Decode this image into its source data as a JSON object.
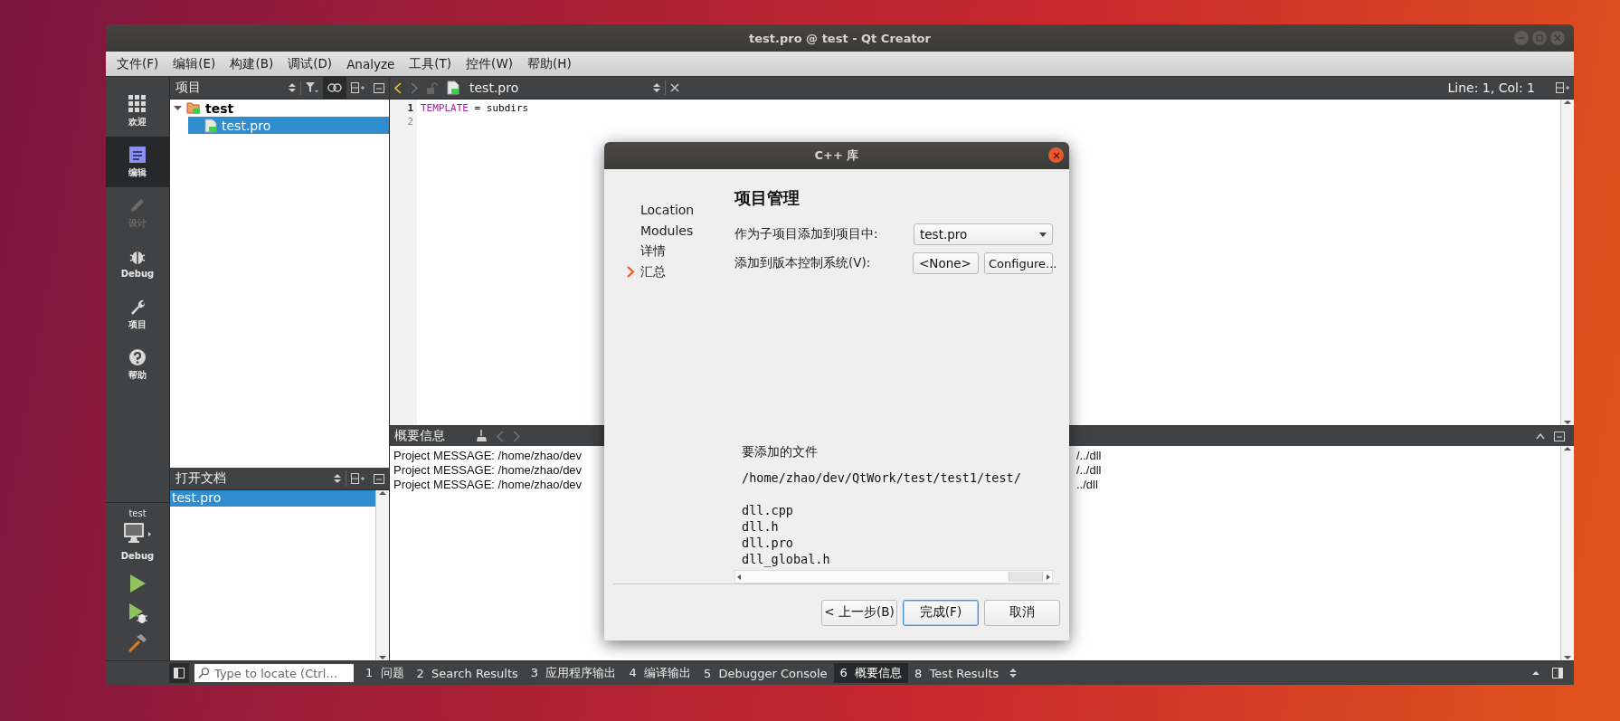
{
  "window": {
    "title": "test.pro @ test - Qt Creator"
  },
  "menu": [
    "文件(F)",
    "编辑(E)",
    "构建(B)",
    "调试(D)",
    "Analyze",
    "工具(T)",
    "控件(W)",
    "帮助(H)"
  ],
  "modes": [
    {
      "label": "欢迎",
      "kind": "welcome",
      "selected": false,
      "disabled": false
    },
    {
      "label": "编辑",
      "kind": "edit",
      "selected": true,
      "disabled": false
    },
    {
      "label": "设计",
      "kind": "design",
      "selected": false,
      "disabled": true
    },
    {
      "label": "Debug",
      "kind": "debug",
      "selected": false,
      "disabled": false
    },
    {
      "label": "项目",
      "kind": "projects",
      "selected": false,
      "disabled": false
    },
    {
      "label": "帮助",
      "kind": "help",
      "selected": false,
      "disabled": false
    }
  ],
  "target": {
    "project": "test",
    "config": "Debug"
  },
  "projects_pane": {
    "title": "项目",
    "tree": [
      {
        "label": "test",
        "kind": "project",
        "expanded": true,
        "selected": false,
        "children": [
          {
            "label": "test.pro",
            "kind": "file",
            "selected": true
          }
        ]
      }
    ]
  },
  "open_documents": {
    "title": "打开文档",
    "items": [
      {
        "label": "test.pro",
        "selected": true
      }
    ]
  },
  "editor": {
    "file": "test.pro",
    "position": "Line: 1, Col: 1",
    "lines": [
      {
        "number": "1",
        "keyword": "TEMPLATE",
        "rest": " = subdirs"
      },
      {
        "number": "2"
      }
    ]
  },
  "output_pane": {
    "title": "概要信息",
    "lines": [
      {
        "left": "Project MESSAGE: /home/zhao/dev",
        "right": "/../dll"
      },
      {
        "left": "Project MESSAGE: /home/zhao/dev",
        "right": "/../dll"
      },
      {
        "left": "Project MESSAGE: /home/zhao/dev",
        "right": "../dll"
      }
    ]
  },
  "status_bar": {
    "locate_placeholder": "Type to locate (Ctrl…",
    "tabs": [
      {
        "label": "1  问题",
        "selected": false
      },
      {
        "label": "2  Search Results",
        "selected": false
      },
      {
        "label": "3  应用程序输出",
        "selected": false
      },
      {
        "label": "4  编译输出",
        "selected": false
      },
      {
        "label": "5  Debugger Console",
        "selected": false
      },
      {
        "label": "6  概要信息",
        "selected": true
      },
      {
        "label": "8  Test Results",
        "selected": false
      }
    ]
  },
  "dialog": {
    "title": "C++ 库",
    "steps": [
      {
        "label": "Location",
        "selected": false
      },
      {
        "label": "Modules",
        "selected": false
      },
      {
        "label": "详情",
        "selected": false
      },
      {
        "label": "汇总",
        "selected": true
      }
    ],
    "heading": "项目管理",
    "add_to_project_label": "作为子项目添加到项目中:",
    "add_to_project_value": "test.pro",
    "vcs_label": "添加到版本控制系统(V):",
    "vcs_value": "<None>",
    "configure": "Configure...",
    "files_label": "要添加的文件",
    "files_path": "/home/zhao/dev/QtWork/test/test1/test/",
    "files": [
      "dll.cpp",
      "dll.h",
      "dll.pro",
      "dll_global.h"
    ],
    "buttons": [
      {
        "label": "< 上一步(B)",
        "default": false
      },
      {
        "label": "完成(F)",
        "default": true
      },
      {
        "label": "取消",
        "default": false
      }
    ]
  }
}
